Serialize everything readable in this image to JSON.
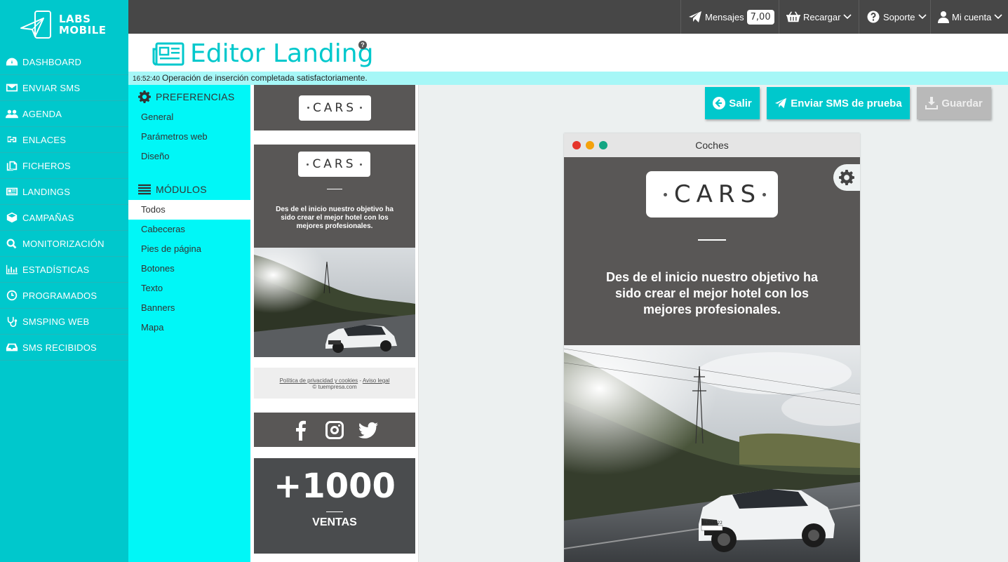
{
  "brand": {
    "line1": "LABS",
    "line2": "MOBILE"
  },
  "sidebar": {
    "items": [
      {
        "label": "DASHBOARD",
        "icon": "dashboard-icon"
      },
      {
        "label": "ENVIAR SMS",
        "icon": "envelope-icon"
      },
      {
        "label": "AGENDA",
        "icon": "users-icon"
      },
      {
        "label": "ENLACES",
        "icon": "link-icon"
      },
      {
        "label": "FICHEROS",
        "icon": "files-icon"
      },
      {
        "label": "LANDINGS",
        "icon": "newspaper-icon"
      },
      {
        "label": "CAMPAÑAS",
        "icon": "cube-icon"
      },
      {
        "label": "MONITORIZACIÓN",
        "icon": "search-icon"
      },
      {
        "label": "ESTADÍSTICAS",
        "icon": "bar-chart-icon"
      },
      {
        "label": "PROGRAMADOS",
        "icon": "clock-icon"
      },
      {
        "label": "SMSPING WEB",
        "icon": "stethoscope-icon"
      },
      {
        "label": "SMS RECIBIDOS",
        "icon": "inbox-icon"
      }
    ]
  },
  "topbar": {
    "messages_label": "Mensajes",
    "messages_count": "7,00",
    "recharge_label": "Recargar",
    "support_label": "Soporte",
    "account_label": "Mi cuenta"
  },
  "header": {
    "title": "Editor Landing",
    "help": "?"
  },
  "status": {
    "time": "16:52:40",
    "message": "Operación de inserción completada satisfactoriamente."
  },
  "preferences": {
    "title": "PREFERENCIAS",
    "items": [
      "General",
      "Parámetros web",
      "Diseño"
    ]
  },
  "modules_menu": {
    "title": "MÓDULOS",
    "items": [
      "Todos",
      "Cabeceras",
      "Pies de página",
      "Botones",
      "Texto",
      "Banners",
      "Mapa"
    ],
    "active_index": 0
  },
  "thumbnails": {
    "logo_text": "CARS",
    "header_text": "Des de el inicio nuestro objetivo ha sido crear el mejor hotel con los mejores profesionales.",
    "footer_privacy": "Política de privacidad y cookies",
    "footer_sep": "-",
    "footer_legal": "Aviso legal",
    "footer_copy": "© tuempresa.com",
    "stats_number": "+1000",
    "stats_label": "VENTAS"
  },
  "actions": {
    "exit_label": "Salir",
    "test_sms_label": "Enviar SMS de prueba",
    "save_label": "Guardar"
  },
  "preview": {
    "window_title": "Coches",
    "logo_text": "CARS",
    "body_text": "Des de el inicio nuestro objetivo ha sido crear el mejor hotel con los mejores profesionales.",
    "plate": "BLDS8322"
  },
  "colors": {
    "accent": "#00c8cc",
    "accent_light": "#00f7f7",
    "topbar": "#474747",
    "module_dark": "#595756",
    "dot_red": "#e5352b",
    "dot_yellow": "#f4a20c",
    "dot_green": "#13a683"
  }
}
